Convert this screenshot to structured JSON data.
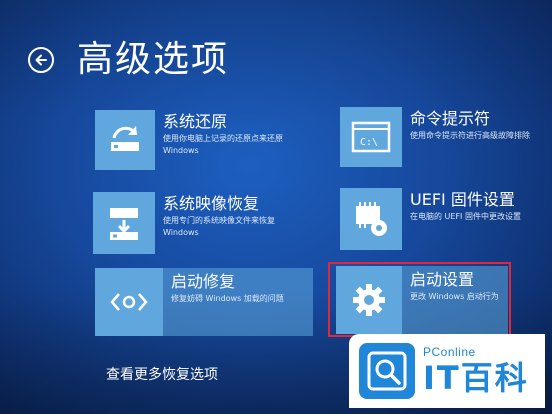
{
  "page": {
    "title": "高级选项"
  },
  "options": {
    "system_restore": {
      "name": "系统还原",
      "desc1": "使用你电脑上记录的还原点来还原",
      "desc2": "Windows"
    },
    "command_prompt": {
      "name": "命令提示符",
      "desc1": "使用命令提示符进行高级故障排除"
    },
    "image_recovery": {
      "name": "系统映像恢复",
      "desc1": "使用专门的系统映像文件来恢复",
      "desc2": "Windows"
    },
    "uefi": {
      "name": "UEFI 固件设置",
      "desc1": "在电脑的 UEFI 固件中更改设置"
    },
    "startup_repair": {
      "name": "启动修复",
      "desc1": "修复妨碍 Windows 加载的问题"
    },
    "startup_settings": {
      "name": "启动设置",
      "desc1": "更改 Windows 启动行为"
    }
  },
  "more_link": "查看更多恢复选项",
  "watermark": {
    "brand_small": "PConline",
    "brand_big": "IT百科"
  },
  "colors": {
    "tile": "#5fa7dd",
    "highlight": "#e0283a",
    "brand": "#1f86d8"
  }
}
